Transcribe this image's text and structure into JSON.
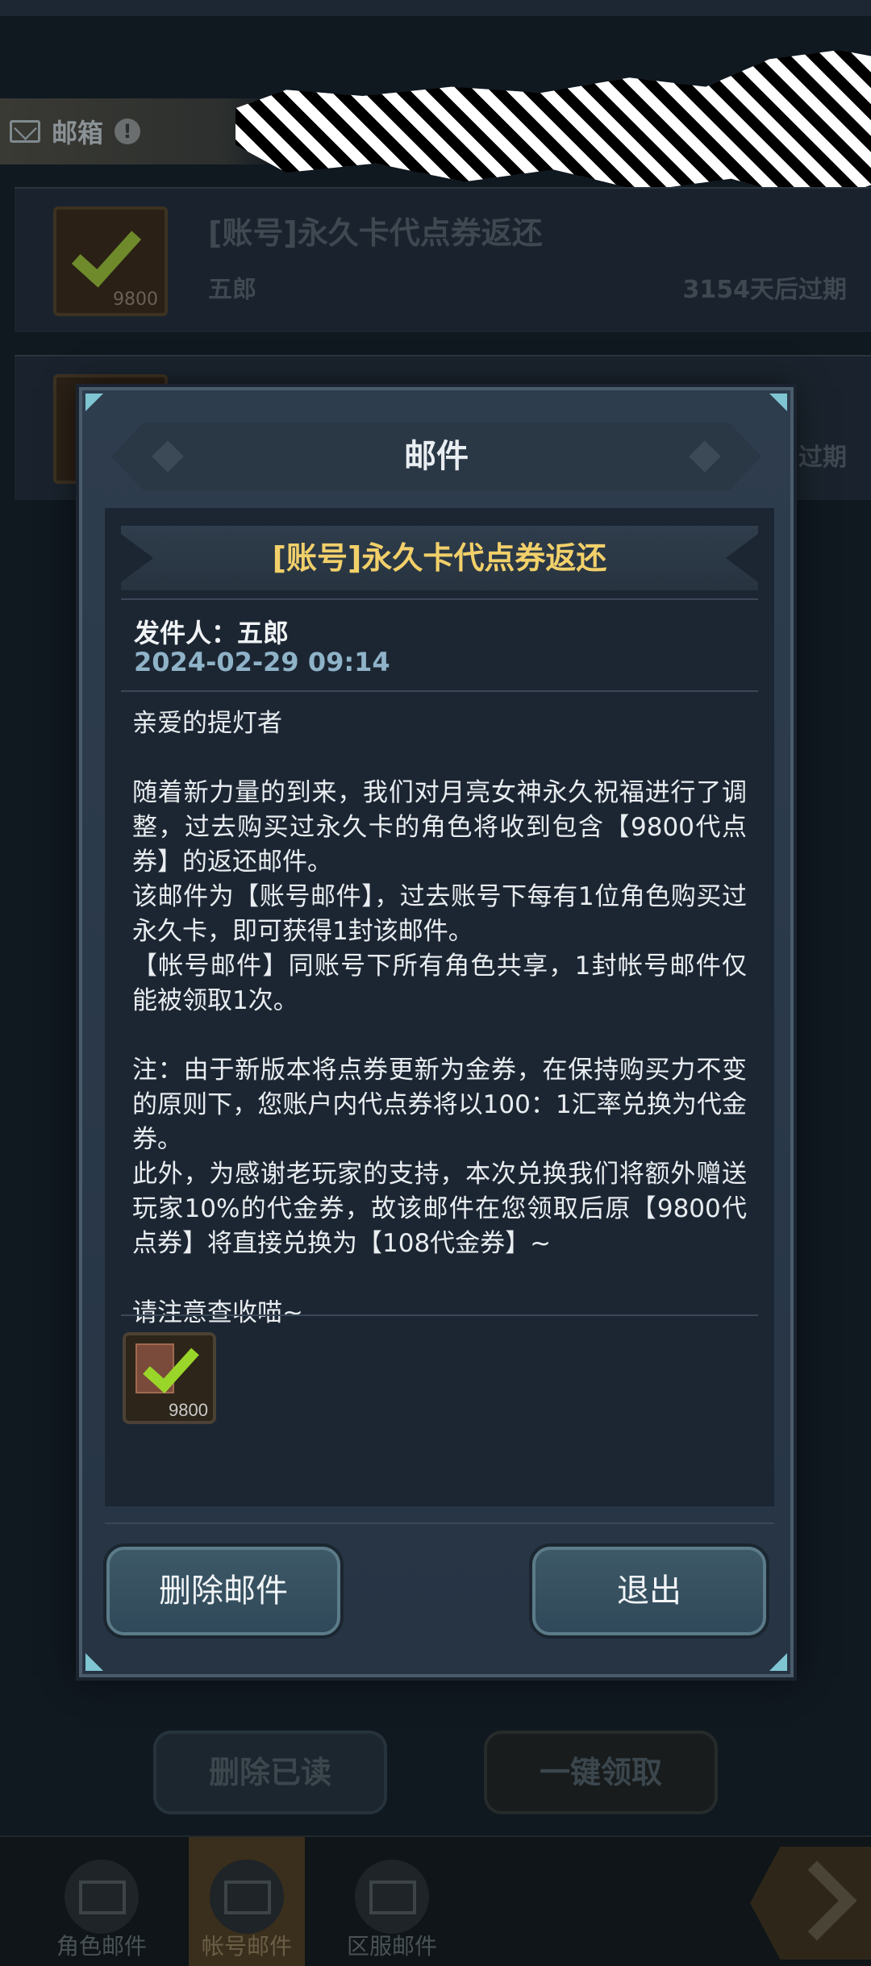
{
  "background": {
    "mailbox_title": "邮箱",
    "mails": [
      {
        "subject": "[账号]永久卡代点券返还",
        "sender": "五郎",
        "expire": "3154天后过期",
        "item_count": "9800"
      },
      {
        "subject": "",
        "sender": "",
        "expire": "过期",
        "item_count": ""
      }
    ],
    "delete_read_label": "删除已读",
    "claim_all_label": "一键领取",
    "tabs": [
      {
        "label": "角色邮件"
      },
      {
        "label": "帐号邮件"
      },
      {
        "label": "区服邮件"
      }
    ]
  },
  "modal": {
    "title": "邮件",
    "subject": "[账号]永久卡代点券返还",
    "sender_line": "发件人：五郎",
    "date": "2024-02-29 09:14",
    "body": [
      "亲爱的提灯者",
      "",
      "随着新力量的到来，我们对月亮女神永久祝福进行了调整，过去购买过永久卡的角色将收到包含【9800代点券】的返还邮件。",
      "该邮件为【账号邮件】，过去账号下每有1位角色购买过永久卡，即可获得1封该邮件。",
      "【帐号邮件】同账号下所有角色共享，1封帐号邮件仅能被领取1次。",
      "",
      "注：由于新版本将点券更新为金券，在保持购买力不变的原则下，您账户内代点券将以100：1汇率兑换为代金券。",
      "此外，为感谢老玩家的支持，本次兑换我们将额外赠送玩家10%的代金券，故该邮件在您领取后原【9800代点券】将直接兑换为【108代金券】~",
      "",
      "请注意查收喵~"
    ],
    "attachment_count": "9800",
    "delete_label": "删除邮件",
    "exit_label": "退出"
  }
}
